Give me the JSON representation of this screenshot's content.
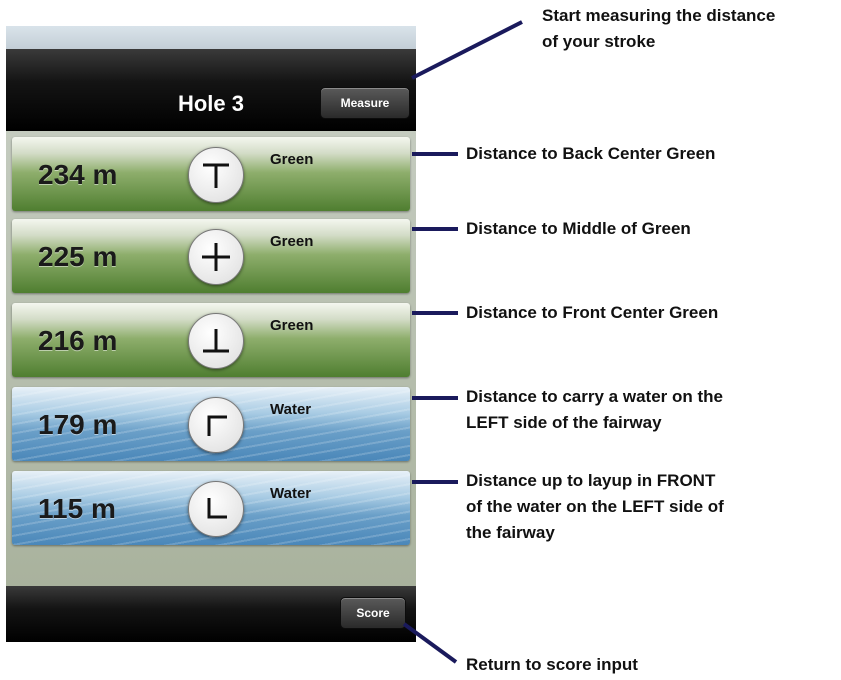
{
  "navbar": {
    "title": "Hole 3",
    "measure_label": "Measure"
  },
  "rows": [
    {
      "distance": "234 m",
      "target": "Green",
      "icon": "back-center-green-icon",
      "surface": "green"
    },
    {
      "distance": "225 m",
      "target": "Green",
      "icon": "middle-green-icon",
      "surface": "green"
    },
    {
      "distance": "216 m",
      "target": "Green",
      "icon": "front-center-green-icon",
      "surface": "green"
    },
    {
      "distance": "179 m",
      "target": "Water",
      "icon": "water-carry-icon",
      "surface": "water"
    },
    {
      "distance": "115 m",
      "target": "Water",
      "icon": "water-layup-icon",
      "surface": "water"
    }
  ],
  "toolbar": {
    "score_label": "Score"
  },
  "callouts": {
    "measure": [
      "Start measuring the distance",
      "of your stroke"
    ],
    "back_center": [
      "Distance to Back Center Green"
    ],
    "middle": [
      "Distance to Middle of Green"
    ],
    "front_center": [
      "Distance to Front Center Green"
    ],
    "water_carry": [
      "Distance to carry a water on the",
      "LEFT side of the fairway"
    ],
    "water_layup": [
      "Distance up to layup in FRONT",
      "of the water on the LEFT side of",
      "the fairway"
    ],
    "score": [
      "Return to score input"
    ]
  },
  "colors": {
    "navbar": "#000000",
    "green_surface": "#5b8a3a",
    "water_surface": "#5e98c5",
    "connector": "#1a1a5c"
  }
}
